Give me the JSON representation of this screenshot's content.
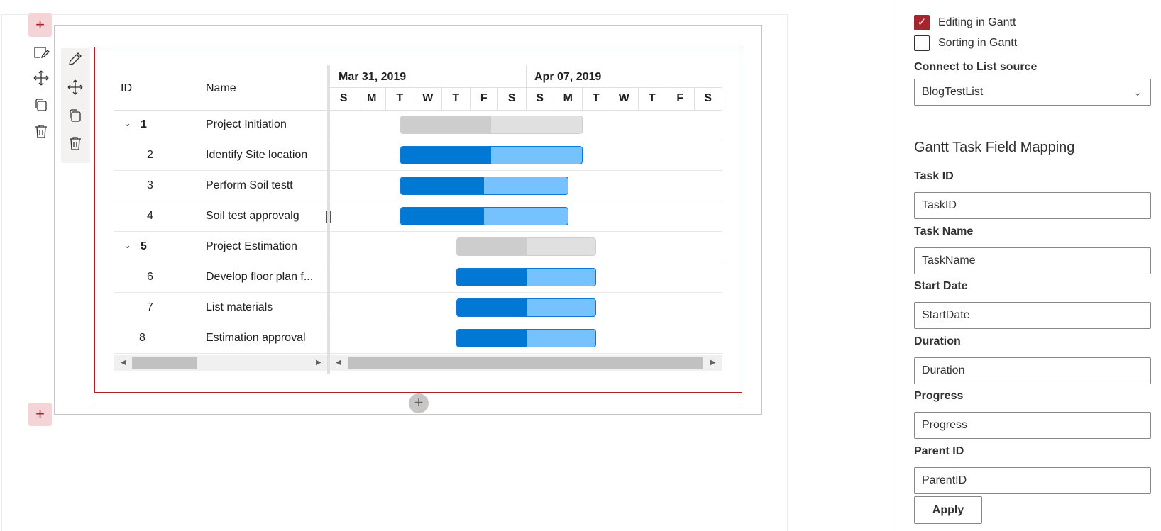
{
  "canvas": {
    "add_section_top": "+",
    "add_section_bottom": "+",
    "add_column": "+"
  },
  "gantt": {
    "columns": {
      "id": "ID",
      "name": "Name"
    },
    "timeline": {
      "weeks": [
        "Mar 31, 2019",
        "Apr 07, 2019"
      ],
      "days": [
        "S",
        "M",
        "T",
        "W",
        "T",
        "F",
        "S",
        "S",
        "M",
        "T",
        "W",
        "T",
        "F",
        "S"
      ]
    },
    "rows": [
      {
        "id": "1",
        "name": "Project Initiation",
        "parent": true,
        "start_day": 2.5,
        "duration": 6.5,
        "progress": 0.5
      },
      {
        "id": "2",
        "name": "Identify Site location",
        "parent": false,
        "start_day": 2.5,
        "duration": 6.5,
        "progress": 0.5
      },
      {
        "id": "3",
        "name": "Perform Soil testt",
        "parent": false,
        "start_day": 2.5,
        "duration": 6,
        "progress": 0.5
      },
      {
        "id": "4",
        "name": "Soil test approvalg",
        "parent": false,
        "start_day": 2.5,
        "duration": 6,
        "progress": 0.5
      },
      {
        "id": "5",
        "name": "Project Estimation",
        "parent": true,
        "start_day": 4.5,
        "duration": 5,
        "progress": 0.5
      },
      {
        "id": "6",
        "name": "Develop floor plan f...",
        "parent": false,
        "start_day": 4.5,
        "duration": 5,
        "progress": 0.5
      },
      {
        "id": "7",
        "name": "List materials",
        "parent": false,
        "start_day": 4.5,
        "duration": 5,
        "progress": 0.5
      },
      {
        "id": "8",
        "name": "Estimation approval",
        "parent": false,
        "start_day": 4.5,
        "duration": 5,
        "progress": 0.5
      }
    ],
    "colors": {
      "parent_bar": "#e0e0e0",
      "parent_fill": "#cdcdcd",
      "child_bar": "#76c2ff",
      "child_fill": "#0078d4"
    }
  },
  "settings": {
    "editing_label": "Editing in Gantt",
    "editing_checked": true,
    "sorting_label": "Sorting in Gantt",
    "sorting_checked": false,
    "connect_label": "Connect to List source",
    "list_source": "BlogTestList",
    "mapping_heading": "Gantt Task Field Mapping",
    "fields": [
      {
        "label": "Task ID",
        "value": "TaskID"
      },
      {
        "label": "Task Name",
        "value": "TaskName"
      },
      {
        "label": "Start Date",
        "value": "StartDate"
      },
      {
        "label": "Duration",
        "value": "Duration"
      },
      {
        "label": "Progress",
        "value": "Progress"
      },
      {
        "label": "Parent ID",
        "value": "ParentID"
      }
    ],
    "apply_label": "Apply",
    "accent_color": "#a4262c"
  }
}
